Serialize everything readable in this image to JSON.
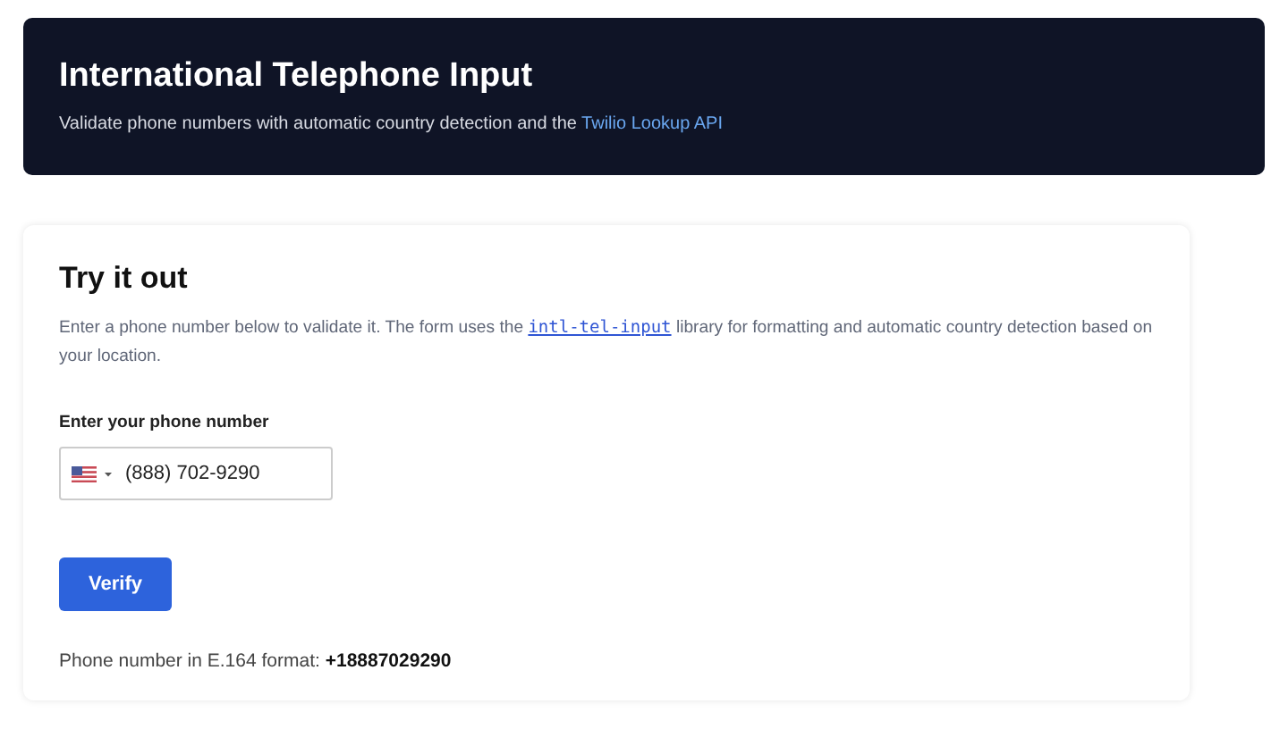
{
  "header": {
    "title": "International Telephone Input",
    "subtitle": "Validate phone numbers with automatic country detection and the ",
    "subtitle_link": "Twilio Lookup API"
  },
  "card": {
    "title": "Try it out",
    "description_before": "Enter a phone number below to validate it. The form uses the ",
    "description_link": "intl-tel-input",
    "description_after": " library for formatting and automatic country detection based on your location.",
    "field_label": "Enter your phone number",
    "phone_value": "(888) 702-9290",
    "button": "Verify",
    "result": "Phone number in E.164 format: **+18887029290**"
  }
}
